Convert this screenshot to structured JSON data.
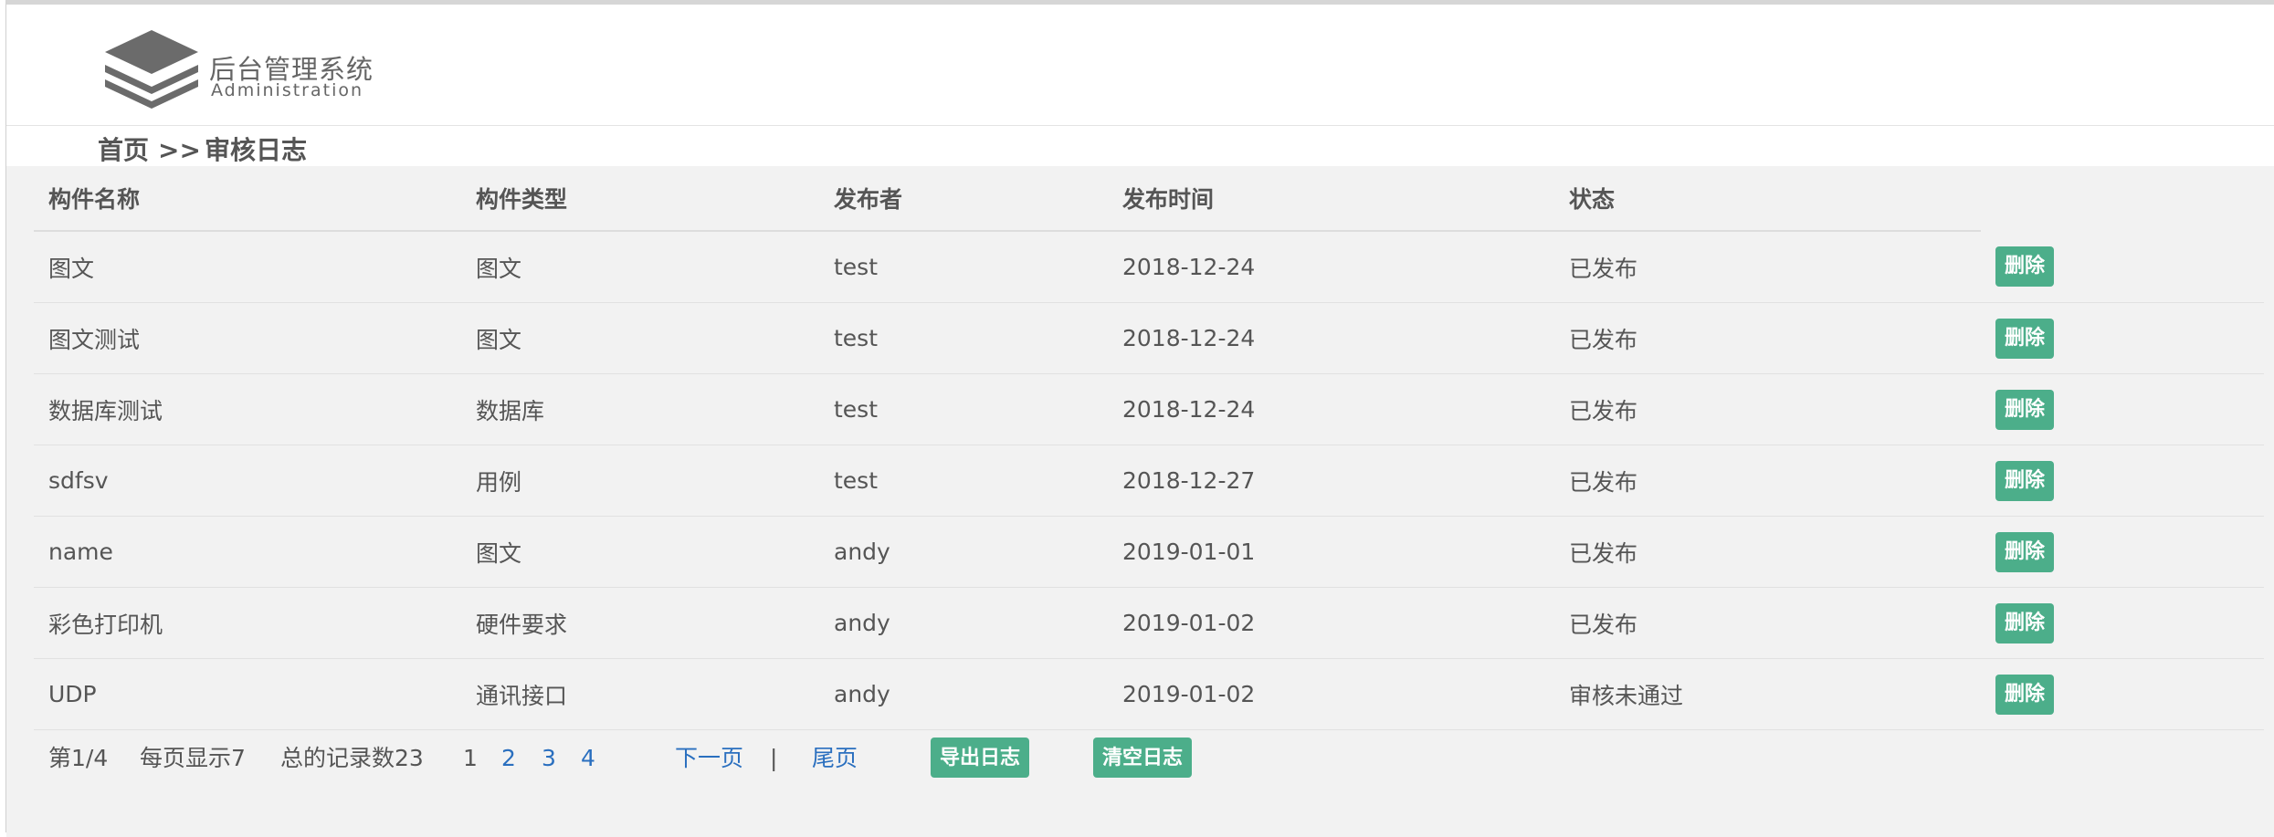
{
  "brand": {
    "title": "后台管理系统",
    "subtitle": "Administration",
    "logo_icon": "stacked-layers-icon"
  },
  "breadcrumb": {
    "home": "首页",
    "separator": ">>",
    "current": "审核日志"
  },
  "table": {
    "headers": [
      "构件名称",
      "构件类型",
      "发布者",
      "发布时间",
      "状态"
    ],
    "action_label": "删除",
    "rows": [
      {
        "name": "图文",
        "type": "图文",
        "publisher": "test",
        "time": "2018-12-24",
        "status": "已发布"
      },
      {
        "name": "图文测试",
        "type": "图文",
        "publisher": "test",
        "time": "2018-12-24",
        "status": "已发布"
      },
      {
        "name": "数据库测试",
        "type": "数据库",
        "publisher": "test",
        "time": "2018-12-24",
        "status": "已发布"
      },
      {
        "name": "sdfsv",
        "type": "用例",
        "publisher": "test",
        "time": "2018-12-27",
        "status": "已发布"
      },
      {
        "name": "name",
        "type": "图文",
        "publisher": "andy",
        "time": "2019-01-01",
        "status": "已发布"
      },
      {
        "name": "彩色打印机",
        "type": "硬件要求",
        "publisher": "andy",
        "time": "2019-01-02",
        "status": "已发布"
      },
      {
        "name": "UDP",
        "type": "通讯接口",
        "publisher": "andy",
        "time": "2019-01-02",
        "status": "审核未通过"
      }
    ]
  },
  "pager": {
    "page_info": "第1/4",
    "per_page": "每页显示7",
    "total": "总的记录数23",
    "pages": [
      "1",
      "2",
      "3",
      "4"
    ],
    "next": "下一页",
    "divider": "|",
    "last": "尾页",
    "export_label": "导出日志",
    "clear_label": "清空日志"
  },
  "colors": {
    "accent_button": "#4cae8a",
    "link": "#2a6fbf",
    "content_bg": "#f2f2f2"
  }
}
